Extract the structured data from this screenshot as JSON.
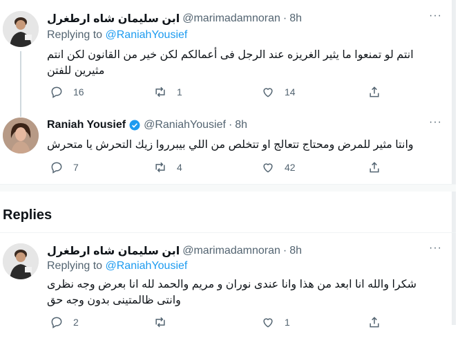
{
  "tweets": [
    {
      "name": "ابن سليمان شاه ارطغرل",
      "handle": "@marimadamnoran",
      "dot": "·",
      "time": "8h",
      "replying_prefix": "Replying to",
      "replying_to": "@RaniahYousief",
      "text": "انتم لو تمنعوا ما يثير الغريزه عند الرجل فى أعمالكم لكن خير من القانون لكن انتم مثيرين للفتن",
      "replies": "16",
      "retweets": "1",
      "likes": "14"
    },
    {
      "name": "Raniah Yousief",
      "handle": "@RaniahYousief",
      "dot": "·",
      "time": "8h",
      "text": "وانتا مثير للمرض ومحتاج تتعالج او تتخلص من اللي بيبرروا زيك التحرش يا متحرش",
      "replies": "7",
      "retweets": "4",
      "likes": "42"
    },
    {
      "name": "ابن سليمان شاه ارطغرل",
      "handle": "@marimadamnoran",
      "dot": "·",
      "time": "8h",
      "replying_prefix": "Replying to",
      "replying_to": "@RaniahYousief",
      "text": "شكرا والله انا ابعد من هذا وانا عندى نوران و مريم والحمد لله انا بعرض وجه نظرى وانتى ظالمتينى بدون وجه حق",
      "replies": "2",
      "retweets": "",
      "likes": "1"
    }
  ],
  "section": {
    "title": "Replies"
  },
  "more_label": "···",
  "colors": {
    "accent": "#1d9bf0",
    "secondary": "#536471",
    "text": "#0f1419"
  },
  "icons": [
    "reply-icon",
    "retweet-icon",
    "like-icon",
    "share-icon",
    "verified-badge-icon",
    "more-icon"
  ]
}
